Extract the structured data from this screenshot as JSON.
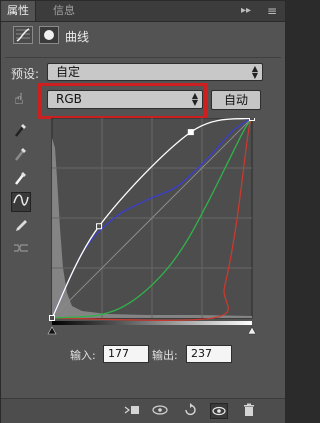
{
  "tabs": [
    {
      "label": "属性",
      "active": true
    },
    {
      "label": "信息",
      "active": false
    }
  ],
  "tab_controls": {
    "collapse": "▸▸",
    "menu": "≡"
  },
  "header": {
    "title": "曲线"
  },
  "preset": {
    "label": "预设:",
    "value": "自定"
  },
  "channel": {
    "value": "RGB"
  },
  "auto_button": {
    "label": "自动"
  },
  "io": {
    "input_label": "输入:",
    "input_value": "177",
    "output_label": "输出:",
    "output_value": "237"
  },
  "colors": {
    "panel": "#535353",
    "composite_curve": "#ffffff",
    "blue_curve": "#3a3fd0",
    "green_curve": "#2fb34a",
    "red_curve": "#c93a2e",
    "highlight": "#cc1f1f"
  },
  "curves": {
    "composite": [
      [
        0,
        0
      ],
      [
        60,
        117
      ],
      [
        177,
        237
      ],
      [
        255,
        255
      ]
    ],
    "blue": [
      [
        0,
        0
      ],
      [
        40,
        85
      ],
      [
        80,
        128
      ],
      [
        120,
        150
      ],
      [
        160,
        168
      ],
      [
        200,
        205
      ],
      [
        230,
        238
      ],
      [
        255,
        255
      ]
    ],
    "green": [
      [
        0,
        0
      ],
      [
        60,
        4
      ],
      [
        100,
        20
      ],
      [
        140,
        55
      ],
      [
        170,
        95
      ],
      [
        200,
        150
      ],
      [
        225,
        200
      ],
      [
        245,
        240
      ],
      [
        255,
        255
      ]
    ],
    "red": [
      [
        0,
        0
      ],
      [
        205,
        0
      ],
      [
        220,
        40
      ],
      [
        235,
        120
      ],
      [
        250,
        235
      ],
      [
        255,
        255
      ]
    ]
  },
  "icons": {
    "tools": [
      "eyedropper-black-icon",
      "eyedropper-gray-icon",
      "eyedropper-white-icon",
      "curve-edit-icon",
      "pencil-icon",
      "smooth-icon"
    ],
    "footer": [
      "clip-to-layer-icon",
      "view-previous-icon",
      "reset-icon",
      "visibility-icon",
      "trash-icon"
    ]
  }
}
